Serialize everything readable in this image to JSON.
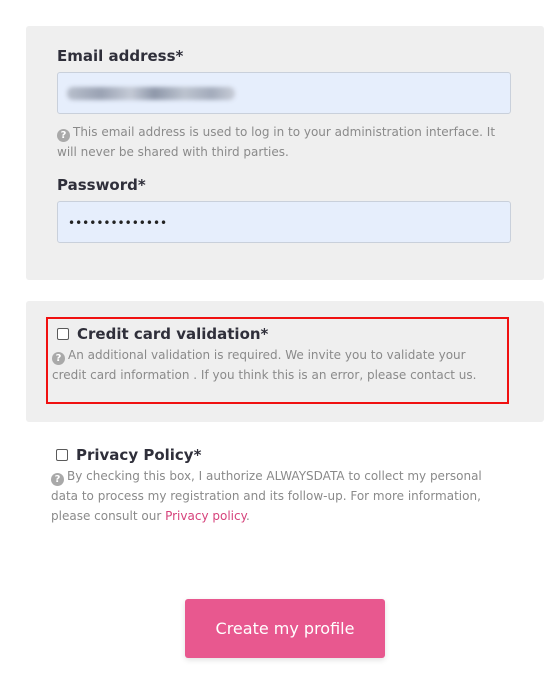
{
  "form": {
    "email": {
      "label": "Email address*",
      "value": "",
      "help": "This email address is used to log in to your administration interface. It will never be shared with third parties."
    },
    "password": {
      "label": "Password*",
      "value": "••••••••••••••"
    },
    "credit_card": {
      "label": "Credit card validation*",
      "help": "An additional validation is required. We invite you to validate your credit card information . If you think this is an error, please contact us."
    },
    "privacy": {
      "label": "Privacy Policy*",
      "help_before": "By checking this box, I authorize ALWAYSDATA to collect my personal data to process my registration and its follow-up. For more information, please consult our ",
      "link_text": "Privacy policy",
      "help_after": "."
    },
    "submit_label": "Create my profile"
  },
  "icons": {
    "help": "question-circle-icon"
  },
  "colors": {
    "accent": "#e8588f",
    "link": "#d6427b",
    "panel": "#efefef",
    "input_bg": "#e6eefc",
    "highlight": "#f01010"
  }
}
